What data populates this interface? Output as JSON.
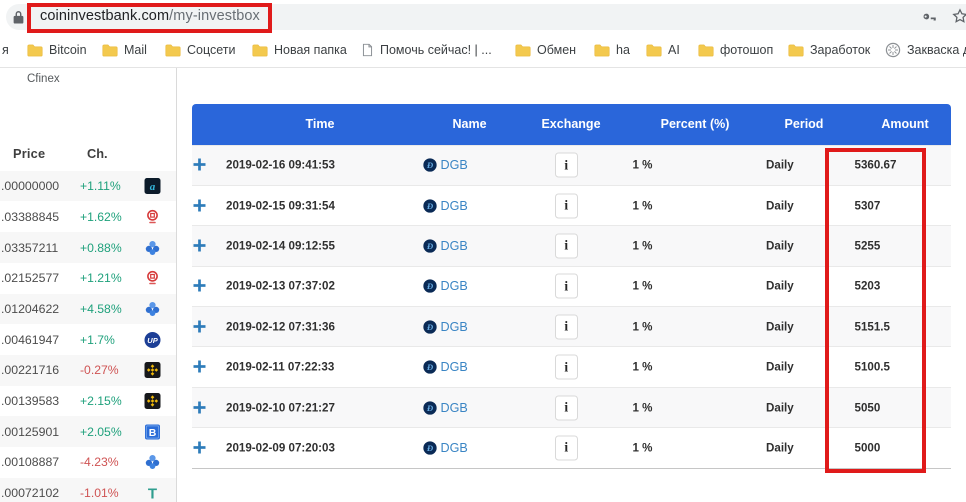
{
  "browser": {
    "url": {
      "domain": "coininvestbank.com",
      "path": "/my-investbox"
    },
    "bookmarks": [
      {
        "label": "я",
        "icon": "none"
      },
      {
        "label": "Bitcoin",
        "icon": "folder"
      },
      {
        "label": "Mail",
        "icon": "folder"
      },
      {
        "label": "Соцсети",
        "icon": "folder"
      },
      {
        "label": "Новая папка",
        "icon": "folder"
      },
      {
        "label": "Помочь сейчас! | ...",
        "icon": "page"
      },
      {
        "label": "Обмен",
        "icon": "folder"
      },
      {
        "label": "ha",
        "icon": "folder"
      },
      {
        "label": "AI",
        "icon": "folder"
      },
      {
        "label": "фотошоп",
        "icon": "folder"
      },
      {
        "label": "Заработок",
        "icon": "folder"
      },
      {
        "label": "Закваска д",
        "icon": "favicon"
      }
    ]
  },
  "sidebar": {
    "exchange_label": "Cfinex",
    "columns": {
      "price": "Price",
      "change": "Ch."
    },
    "rows": [
      {
        "price": ".00000000",
        "change": "+1.11%",
        "direction": "up",
        "icon": "alqo"
      },
      {
        "price": ".03388845",
        "change": "+1.62%",
        "direction": "up",
        "icon": "zb"
      },
      {
        "price": ".03357211",
        "change": "+0.88%",
        "direction": "up",
        "icon": "cluster"
      },
      {
        "price": ".02152577",
        "change": "+1.21%",
        "direction": "up",
        "icon": "zb"
      },
      {
        "price": ".01204622",
        "change": "+4.58%",
        "direction": "up",
        "icon": "cluster"
      },
      {
        "price": ".00461947",
        "change": "+1.7%",
        "direction": "up",
        "icon": "up"
      },
      {
        "price": ".00221716",
        "change": "-0.27%",
        "direction": "down",
        "icon": "binance"
      },
      {
        "price": ".00139583",
        "change": "+2.15%",
        "direction": "up",
        "icon": "binance"
      },
      {
        "price": ".00125901",
        "change": "+2.05%",
        "direction": "up",
        "icon": "bsquare"
      },
      {
        "price": ".00108887",
        "change": "-4.23%",
        "direction": "down",
        "icon": "cluster"
      },
      {
        "price": ".00072102",
        "change": "-1.01%",
        "direction": "down",
        "icon": "tcoin"
      }
    ]
  },
  "table": {
    "headers": [
      "Time",
      "Name",
      "Exchange",
      "Percent (%)",
      "Period",
      "Amount"
    ],
    "info_label": "i",
    "rows": [
      {
        "time": "2019-02-16 09:41:53",
        "name": "DGB",
        "percent": "1 %",
        "period": "Daily",
        "amount": "5360.67"
      },
      {
        "time": "2019-02-15 09:31:54",
        "name": "DGB",
        "percent": "1 %",
        "period": "Daily",
        "amount": "5307"
      },
      {
        "time": "2019-02-14 09:12:55",
        "name": "DGB",
        "percent": "1 %",
        "period": "Daily",
        "amount": "5255"
      },
      {
        "time": "2019-02-13 07:37:02",
        "name": "DGB",
        "percent": "1 %",
        "period": "Daily",
        "amount": "5203"
      },
      {
        "time": "2019-02-12 07:31:36",
        "name": "DGB",
        "percent": "1 %",
        "period": "Daily",
        "amount": "5151.5"
      },
      {
        "time": "2019-02-11 07:22:33",
        "name": "DGB",
        "percent": "1 %",
        "period": "Daily",
        "amount": "5100.5"
      },
      {
        "time": "2019-02-10 07:21:27",
        "name": "DGB",
        "percent": "1 %",
        "period": "Daily",
        "amount": "5050"
      },
      {
        "time": "2019-02-09 07:20:03",
        "name": "DGB",
        "percent": "1 %",
        "period": "Daily",
        "amount": "5000"
      }
    ]
  },
  "annotations": {
    "color": "#e01a1a"
  }
}
